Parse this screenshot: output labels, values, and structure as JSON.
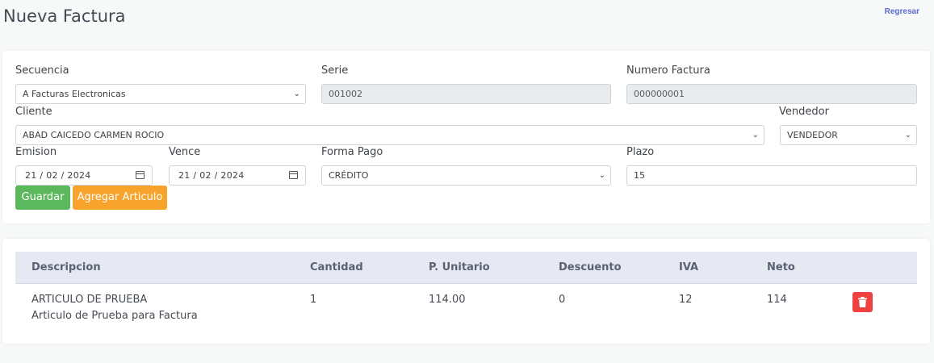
{
  "page": {
    "title": "Nueva Factura",
    "back_link": "Regresar"
  },
  "form": {
    "secuencia": {
      "label": "Secuencia",
      "value": "A Facturas Electronicas"
    },
    "serie": {
      "label": "Serie",
      "value": "001002"
    },
    "numero_factura": {
      "label": "Numero Factura",
      "value": "000000001"
    },
    "cliente": {
      "label": "Cliente",
      "value": "ABAD CAICEDO CARMEN ROCIO"
    },
    "vendedor": {
      "label": "Vendedor",
      "value": "VENDEDOR"
    },
    "emision": {
      "label": "Emision",
      "value": "21 / 02 / 2024"
    },
    "vence": {
      "label": "Vence",
      "value": "21 / 02 / 2024"
    },
    "forma_pago": {
      "label": "Forma Pago",
      "value": "CRÉDITO"
    },
    "plazo": {
      "label": "Plazo",
      "value": "15"
    },
    "buttons": {
      "guardar": "Guardar",
      "agregar": "Agregar Articulo"
    }
  },
  "table": {
    "headers": [
      "Descripcion",
      "Cantidad",
      "P. Unitario",
      "Descuento",
      "IVA",
      "Neto"
    ],
    "rows": [
      {
        "name": "ARTICULO DE PRUEBA",
        "description": "Articulo de Prueba para Factura",
        "cantidad": "1",
        "p_unitario": "114.00",
        "descuento": "0",
        "iva": "12",
        "neto": "114"
      }
    ]
  },
  "colors": {
    "save_button": "#5cb85c",
    "add_button": "#f7a32c",
    "delete_button": "#f04141",
    "link": "#5b6bd1"
  },
  "icons": {
    "delete": "trash-icon",
    "date": "calendar-icon",
    "select": "chevron-down-icon"
  }
}
